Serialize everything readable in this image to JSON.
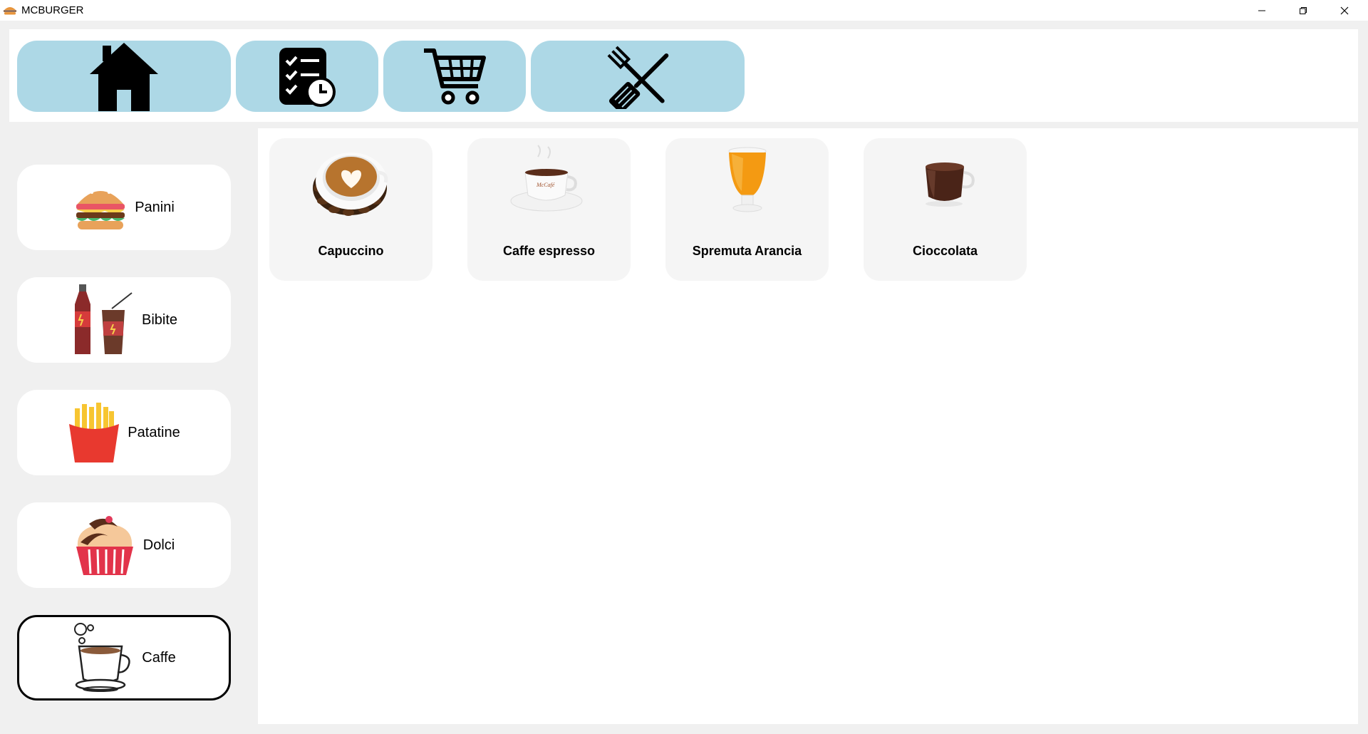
{
  "window": {
    "title": "MCBURGER",
    "icon": "burger-icon"
  },
  "topnav": {
    "buttons": [
      {
        "icon": "home-icon"
      },
      {
        "icon": "order-checklist-clock-icon"
      },
      {
        "icon": "shopping-cart-icon"
      },
      {
        "icon": "spatula-fork-icon"
      }
    ],
    "button_color": "#add8e6"
  },
  "sidebar": {
    "categories": [
      {
        "label": "Panini",
        "icon": "burger-icon"
      },
      {
        "label": "Bibite",
        "icon": "soda-bottle-cup-icon"
      },
      {
        "label": "Patatine",
        "icon": "french-fries-icon"
      },
      {
        "label": "Dolci",
        "icon": "cupcake-icon"
      },
      {
        "label": "Caffe",
        "icon": "coffee-cup-icon",
        "selected": true
      }
    ]
  },
  "products": [
    {
      "name": "Capuccino",
      "image": "cappuccino-image"
    },
    {
      "name": "Caffe espresso",
      "image": "espresso-image"
    },
    {
      "name": "Spremuta Arancia",
      "image": "orange-juice-image"
    },
    {
      "name": "Cioccolata",
      "image": "hot-chocolate-image"
    }
  ]
}
